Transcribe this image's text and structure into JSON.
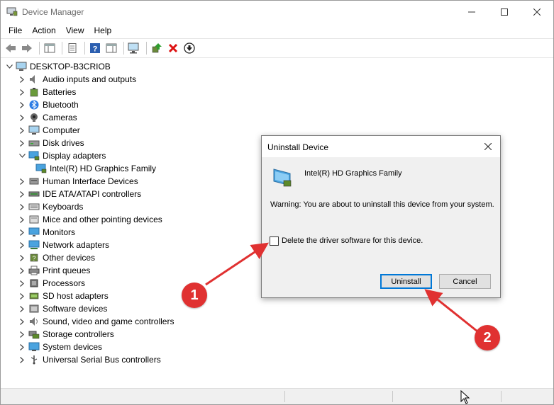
{
  "window": {
    "title": "Device Manager"
  },
  "menu": [
    "File",
    "Action",
    "View",
    "Help"
  ],
  "tree": {
    "root": "DESKTOP-B3CRIOB",
    "items": [
      {
        "label": "Audio inputs and outputs",
        "icon": "speaker-icon",
        "expanded": false
      },
      {
        "label": "Batteries",
        "icon": "battery-icon",
        "expanded": false
      },
      {
        "label": "Bluetooth",
        "icon": "bluetooth-icon",
        "expanded": false
      },
      {
        "label": "Cameras",
        "icon": "camera-icon",
        "expanded": false
      },
      {
        "label": "Computer",
        "icon": "computer-icon",
        "expanded": false
      },
      {
        "label": "Disk drives",
        "icon": "disk-drive-icon",
        "expanded": false
      },
      {
        "label": "Display adapters",
        "icon": "display-adapter-icon",
        "expanded": true
      },
      {
        "label": "Intel(R) HD Graphics Family",
        "icon": "display-adapter-icon",
        "child": true
      },
      {
        "label": "Human Interface Devices",
        "icon": "hid-icon",
        "expanded": false
      },
      {
        "label": "IDE ATA/ATAPI controllers",
        "icon": "ide-controller-icon",
        "expanded": false
      },
      {
        "label": "Keyboards",
        "icon": "keyboard-icon",
        "expanded": false
      },
      {
        "label": "Mice and other pointing devices",
        "icon": "mouse-icon",
        "expanded": false
      },
      {
        "label": "Monitors",
        "icon": "monitor-icon",
        "expanded": false
      },
      {
        "label": "Network adapters",
        "icon": "network-adapter-icon",
        "expanded": false
      },
      {
        "label": "Other devices",
        "icon": "other-devices-icon",
        "expanded": false
      },
      {
        "label": "Print queues",
        "icon": "printer-icon",
        "expanded": false
      },
      {
        "label": "Processors",
        "icon": "processor-icon",
        "expanded": false
      },
      {
        "label": "SD host adapters",
        "icon": "sd-card-icon",
        "expanded": false
      },
      {
        "label": "Software devices",
        "icon": "software-device-icon",
        "expanded": false
      },
      {
        "label": "Sound, video and game controllers",
        "icon": "sound-controller-icon",
        "expanded": false
      },
      {
        "label": "Storage controllers",
        "icon": "storage-controller-icon",
        "expanded": false
      },
      {
        "label": "System devices",
        "icon": "system-device-icon",
        "expanded": false
      },
      {
        "label": "Universal Serial Bus controllers",
        "icon": "usb-icon",
        "expanded": false
      }
    ]
  },
  "dialog": {
    "title": "Uninstall Device",
    "device_name": "Intel(R) HD Graphics Family",
    "warning": "Warning: You are about to uninstall this device from your system.",
    "checkbox_label": "Delete the driver software for this device.",
    "checkbox_checked": false,
    "uninstall_label": "Uninstall",
    "cancel_label": "Cancel"
  },
  "annotations": [
    "1",
    "2"
  ],
  "colors": {
    "annotation": "#e03131",
    "focus": "#0078d7"
  }
}
